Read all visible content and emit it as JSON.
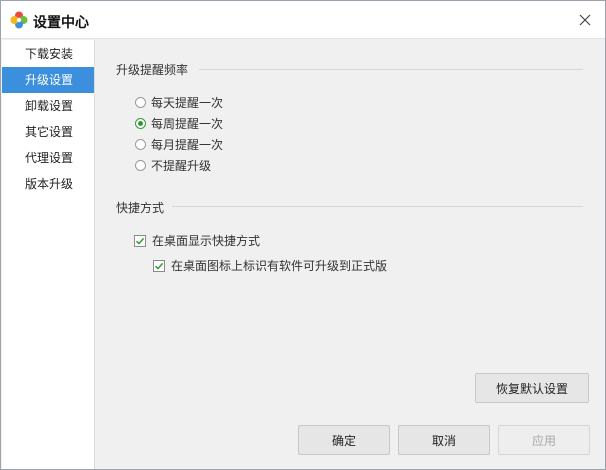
{
  "window": {
    "title": "设置中心",
    "icons": {
      "app": "colorful-flower-icon",
      "close": "close-icon"
    }
  },
  "sidebar": {
    "items": [
      {
        "label": "下载安装",
        "active": false
      },
      {
        "label": "升级设置",
        "active": true
      },
      {
        "label": "卸载设置",
        "active": false
      },
      {
        "label": "其它设置",
        "active": false
      },
      {
        "label": "代理设置",
        "active": false
      },
      {
        "label": "版本升级",
        "active": false
      }
    ],
    "accent_color": "#3c8fdd"
  },
  "upgrade_reminder": {
    "title": "升级提醒频率",
    "options": [
      {
        "label": "每天提醒一次",
        "checked": false
      },
      {
        "label": "每周提醒一次",
        "checked": true
      },
      {
        "label": "每月提醒一次",
        "checked": false
      },
      {
        "label": "不提醒升级",
        "checked": false
      }
    ]
  },
  "shortcut": {
    "title": "快捷方式",
    "options": [
      {
        "label": "在桌面显示快捷方式",
        "checked": true
      },
      {
        "label": "在桌面图标上标识有软件可升级到正式版",
        "checked": true
      }
    ]
  },
  "buttons": {
    "restore_default": "恢复默认设置",
    "ok": "确定",
    "cancel": "取消",
    "apply": "应用"
  }
}
